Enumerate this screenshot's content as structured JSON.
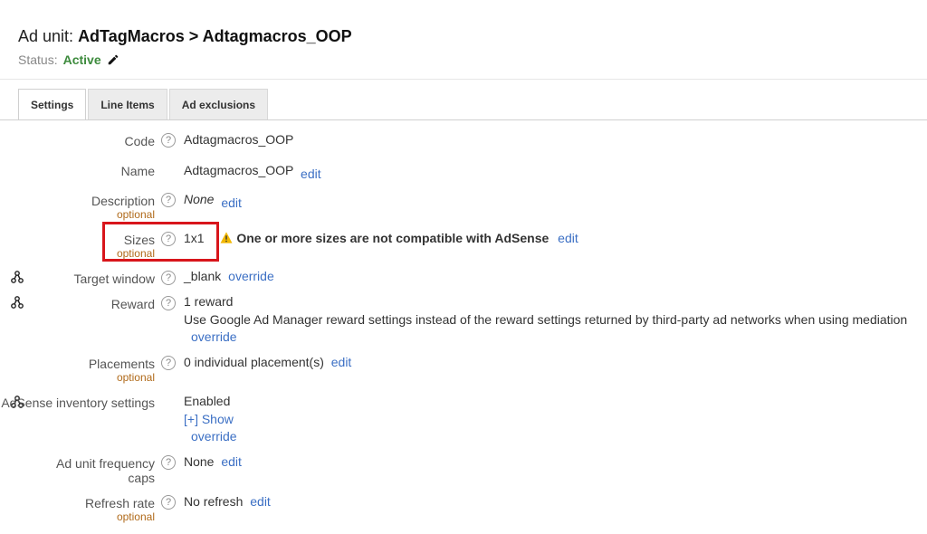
{
  "header": {
    "title_prefix": "Ad unit:",
    "title_name": "AdTagMacros > Adtagmacros_OOP",
    "status_label": "Status:",
    "status_value": "Active"
  },
  "tabs": [
    {
      "label": "Settings",
      "active": true
    },
    {
      "label": "Line Items",
      "active": false
    },
    {
      "label": "Ad exclusions",
      "active": false
    }
  ],
  "help_glyph": "?",
  "settings": {
    "code": {
      "label": "Code",
      "value": "Adtagmacros_OOP"
    },
    "name": {
      "label": "Name",
      "value": "Adtagmacros_OOP",
      "action": "edit"
    },
    "description": {
      "label": "Description",
      "sub": "optional",
      "value": "None",
      "action": "edit"
    },
    "sizes": {
      "label": "Sizes",
      "sub": "optional",
      "value": "1x1",
      "warning": "One or more sizes are not compatible with AdSense",
      "action": "edit"
    },
    "target_window": {
      "label": "Target window",
      "value": "_blank",
      "action": "override"
    },
    "reward": {
      "label": "Reward",
      "value": "1 reward",
      "description": "Use Google Ad Manager reward settings instead of the reward settings returned by third-party ad networks when using mediation",
      "action": "override"
    },
    "placements": {
      "label": "Placements",
      "sub": "optional",
      "value": "0 individual placement(s)",
      "action": "edit"
    },
    "adsense": {
      "label": "AdSense inventory settings",
      "value": "Enabled",
      "show": "[+] Show",
      "action": "override"
    },
    "frequency": {
      "label_line1": "Ad unit frequency",
      "label_line2": "caps",
      "value": "None",
      "action": "edit"
    },
    "refresh": {
      "label": "Refresh rate",
      "sub": "optional",
      "value": "No refresh",
      "action": "edit"
    }
  },
  "colors": {
    "link": "#3b6fc4",
    "active_status": "#3d8b3d",
    "optional": "#b06a1a",
    "highlight_box": "#d8151b",
    "warning": "#f2b800"
  }
}
